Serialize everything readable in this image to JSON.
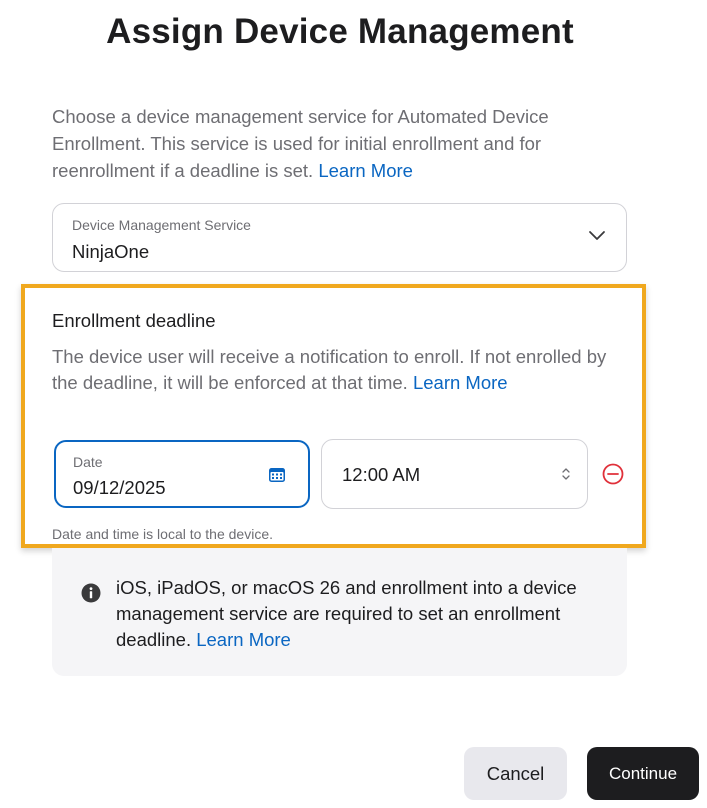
{
  "dialog": {
    "title": "Assign Device Management",
    "intro_text": "Choose a device management service for Automated Device Enrollment. This service is used for initial enrollment and for reenrollment if a deadline is set.",
    "intro_link": "Learn More"
  },
  "service_select": {
    "label": "Device Management Service",
    "value": "NinjaOne",
    "icon": "chevron-down-icon"
  },
  "deadline": {
    "title": "Enrollment deadline",
    "description": "The device user will receive a notification to enroll. If not enrolled by the deadline, it will be enforced at that time.",
    "link": "Learn More",
    "date_label": "Date",
    "date_value": "09/12/2025",
    "time_value": "12:00 AM",
    "footnote": "Date and time is local to the device.",
    "highlight_color": "#f0a81e"
  },
  "info": {
    "text": "iOS, iPadOS, or macOS 26 and enrollment into a device management service are required to set an enrollment deadline.",
    "link": "Learn More",
    "icon": "info-icon"
  },
  "buttons": {
    "cancel": "Cancel",
    "continue": "Continue"
  },
  "colors": {
    "accent": "#0a66c2",
    "remove": "#e0303a",
    "primary_button": "#1d1d1f"
  }
}
